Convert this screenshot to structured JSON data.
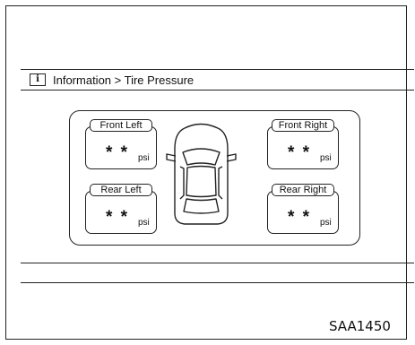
{
  "header": {
    "icon_text": "i",
    "title": "Information > Tire Pressure"
  },
  "tires": {
    "front_left": {
      "label": "Front Left",
      "value": "* *",
      "unit": "psi"
    },
    "front_right": {
      "label": "Front Right",
      "value": "* *",
      "unit": "psi"
    },
    "rear_left": {
      "label": "Rear Left",
      "value": "* *",
      "unit": "psi"
    },
    "rear_right": {
      "label": "Rear Right",
      "value": "* *",
      "unit": "psi"
    }
  },
  "caption": "SAA1450",
  "icons": {
    "info": "info-icon",
    "car": "car-top-view-icon"
  }
}
